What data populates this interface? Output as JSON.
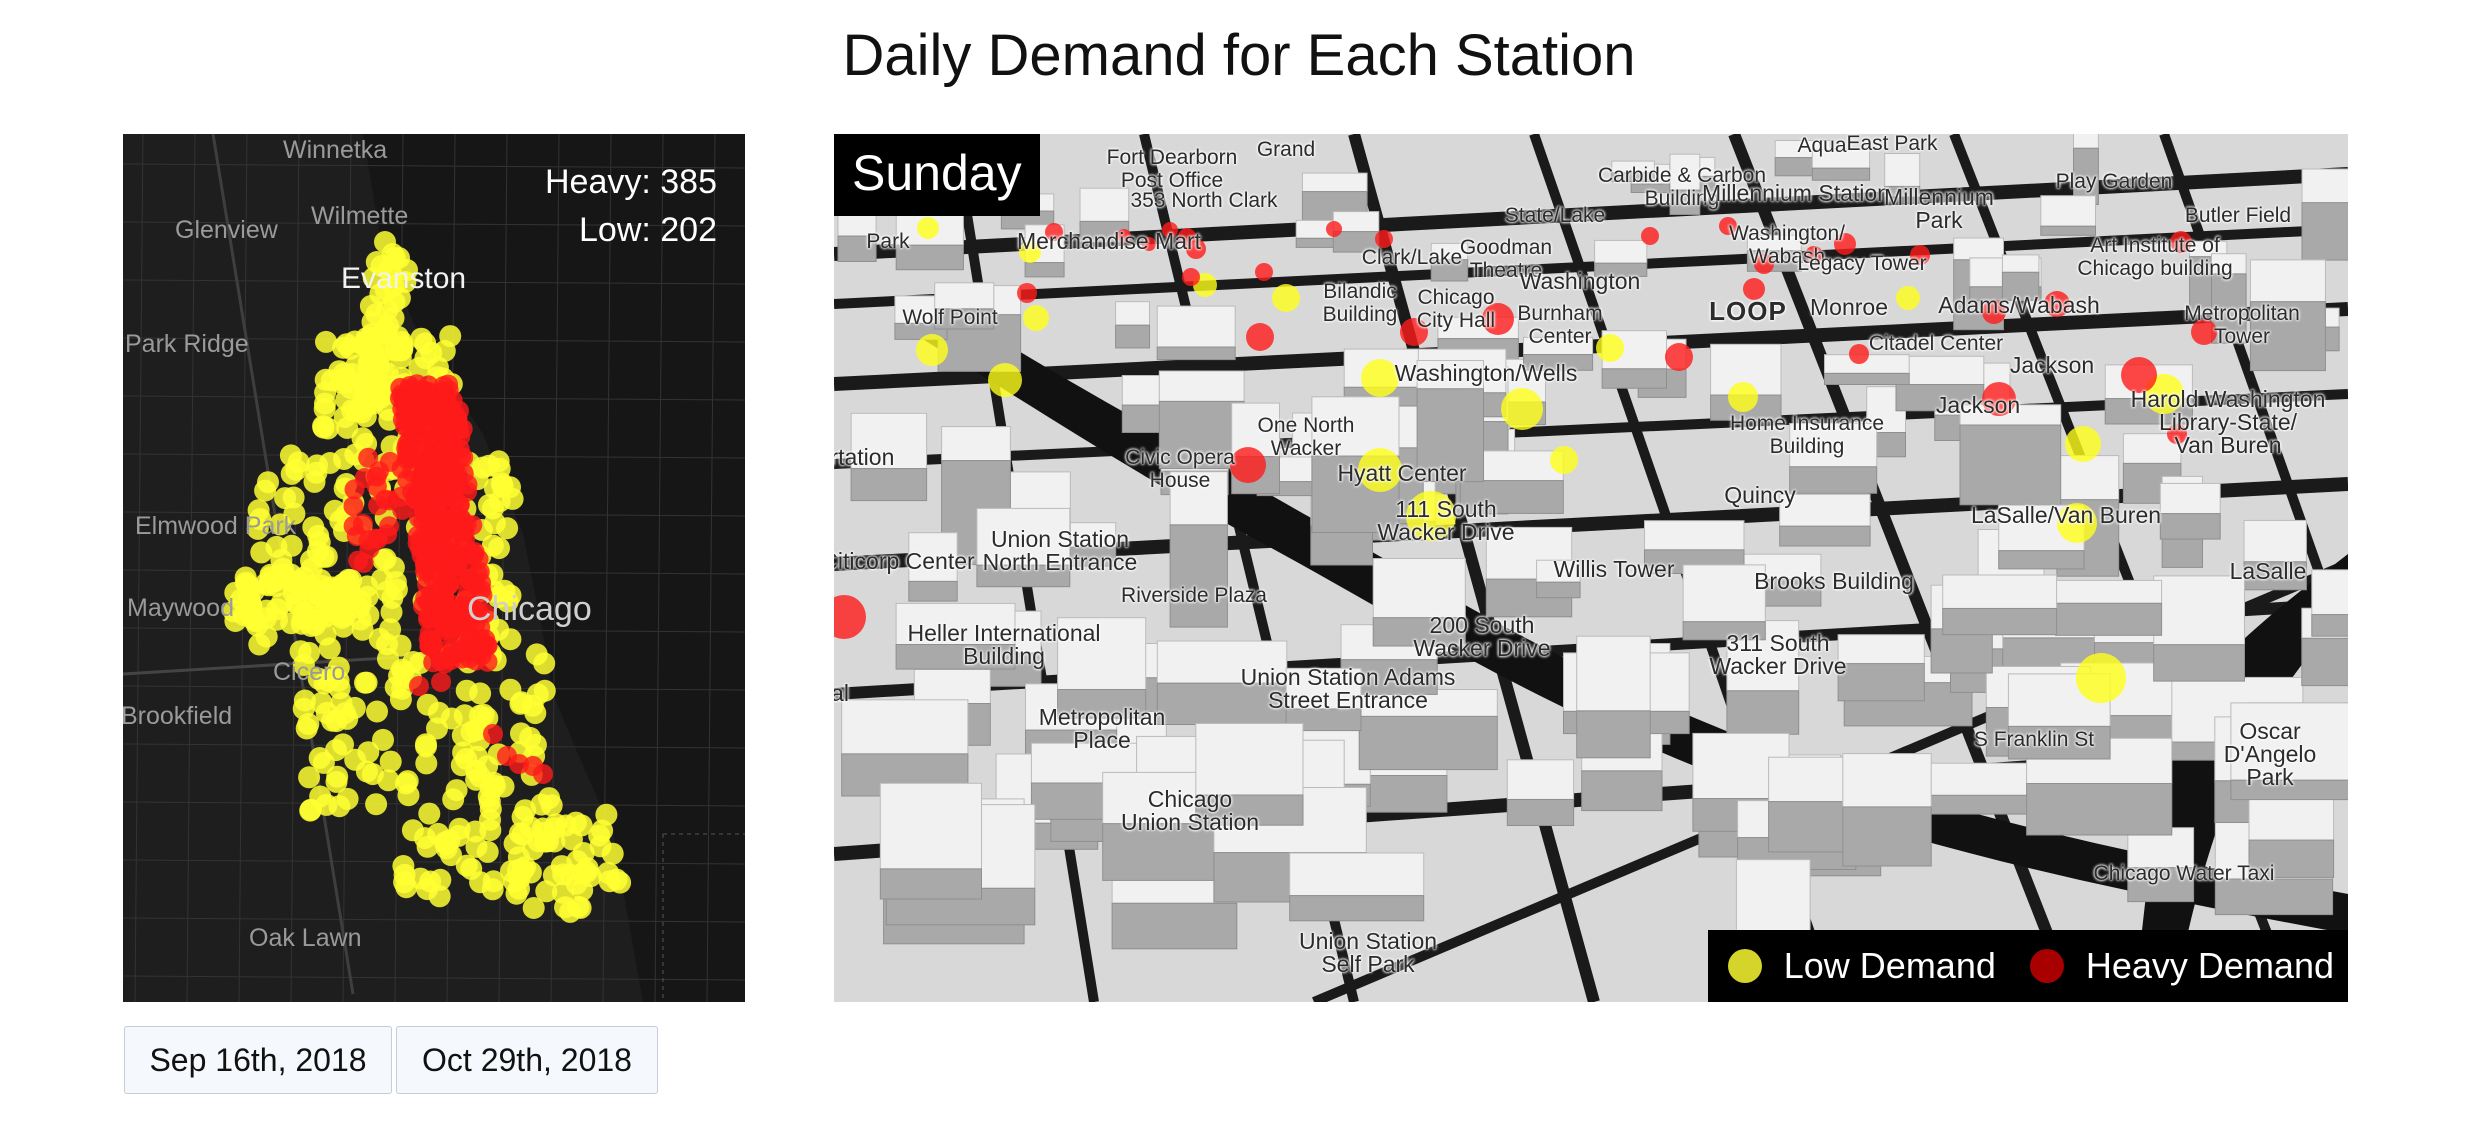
{
  "page": {
    "title": "Daily Demand for Each Station"
  },
  "overview_map": {
    "counts": {
      "heavy": "Heavy: 385",
      "low": "Low: 202"
    },
    "place_labels": [
      "Winnetka",
      "Wilmette",
      "Glenview",
      "Evanston",
      "Park Ridge",
      "Elmwood Park",
      "Maywood",
      "Cicero",
      "Brookfield",
      "Oak Lawn",
      "Chicago"
    ],
    "colors": {
      "low": "#ffff33",
      "heavy": "#ff1a1a",
      "background": "#1e1e1e"
    }
  },
  "date_buttons": {
    "start": "Sep 16th, 2018",
    "end": "Oct 29th, 2018"
  },
  "detail_map": {
    "day": "Sunday",
    "labels": {
      "fort_dearborn": "Fort Dearborn\nPost Office",
      "grand": "Grand",
      "aqua": "Aqua",
      "east_park": "East Park",
      "carbide": "Carbide & Carbon\nBuilding",
      "n353": "353 North Clark",
      "millennium_station": "Millennium Station",
      "millennium_park": "Millennium\nPark",
      "play_garden": "Play Garden",
      "butler": "Butler Field",
      "state_lake": "State/Lake",
      "park": "Park",
      "merchandise": "Merchandise Mart",
      "clark_lake": "Clark/Lake",
      "goodman": "Goodman\nTheatre",
      "washington_wabash": "Washington/\nWabash",
      "legacy": "Legacy Tower",
      "art_institute": "Art Institute of\nChicago building",
      "washington": "Washington",
      "wolf_point": "Wolf Point",
      "bilandic": "Bilandic\nBuilding",
      "chicago_city_hall": "Chicago\nCity Hall",
      "burnham": "Burnham\nCenter",
      "loop": "LOOP",
      "monroe": "Monroe",
      "adams_wabash": "Adams/Wabash",
      "metropolitan_tower": "Metropolitan\nTower",
      "citadel": "Citadel Center",
      "washington_wells": "Washington/Wells",
      "jackson_1": "Jackson",
      "jackson_2": "Jackson",
      "harold": "Harold Washington\nLibrary-State/\nVan Buren",
      "one_north_wacker": "One North\nWacker",
      "home_insurance": "Home Insurance\nBuilding",
      "civic_opera": "Civic Opera\nHouse",
      "ortation": "ortation",
      "hyatt": "Hyatt Center",
      "south_111": "111 South\nWacker Drive",
      "quincy": "Quincy",
      "lasalle_vanburen": "LaSalle/Van Buren",
      "union_north": "Union Station\nNorth Entrance",
      "citicorp": "Citicorp Center",
      "willis": "Willis Tower",
      "brooks": "Brooks Building",
      "lasalle": "LaSalle",
      "heller": "Heller International\nBuilding",
      "south_200": "200 South\nWacker Drive",
      "south_311": "311 South\nWacker Drive",
      "union_adams": "Union Station Adams\nStreet Entrance",
      "al": "al",
      "metropolitan_place": "Metropolitan\nPlace",
      "chicago_union": "Chicago\nUnion Station",
      "oscar": "Oscar\nD'Angelo\nPark",
      "union_self_park": "Union Station\nSelf Park",
      "riverside": "Riverside Plaza",
      "s_franklin": "S Franklin St",
      "water_taxi": "Chicago Water Taxi"
    },
    "legend": [
      {
        "label": "Low Demand",
        "color": "#d4d42a"
      },
      {
        "label": "Heavy Demand",
        "color": "#a80000"
      }
    ]
  }
}
